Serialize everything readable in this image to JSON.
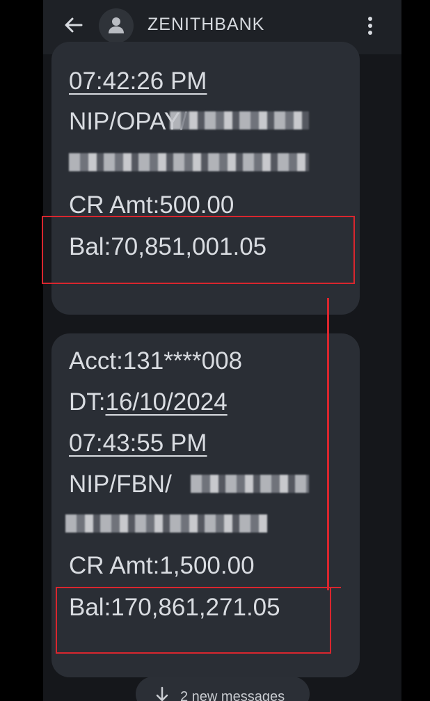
{
  "header": {
    "title": "ZENITHBANK",
    "back_icon": "arrow-left-icon",
    "avatar_icon": "person-icon",
    "menu_icon": "more-vert-icon"
  },
  "messages": [
    {
      "time": "07:42:26 PM",
      "ref_partial": "NIP/OPAY/",
      "credit": "CR Amt:500.00",
      "balance": "Bal:70,851,001.05"
    },
    {
      "account": "Acct:131****008",
      "date_label": "DT:",
      "date": "16/10/2024",
      "time": "07:43:55 PM",
      "ref_partial": "NIP/FBN/",
      "credit": "CR Amt:1,500.00",
      "balance": "Bal:170,861,271.05"
    }
  ],
  "new_messages": {
    "label": "2 new messages",
    "icon": "arrow-down-icon"
  },
  "colors": {
    "background": "#15171b",
    "bubble": "#2a2e35",
    "text": "#d9dce1",
    "highlight": "#d9262e"
  }
}
